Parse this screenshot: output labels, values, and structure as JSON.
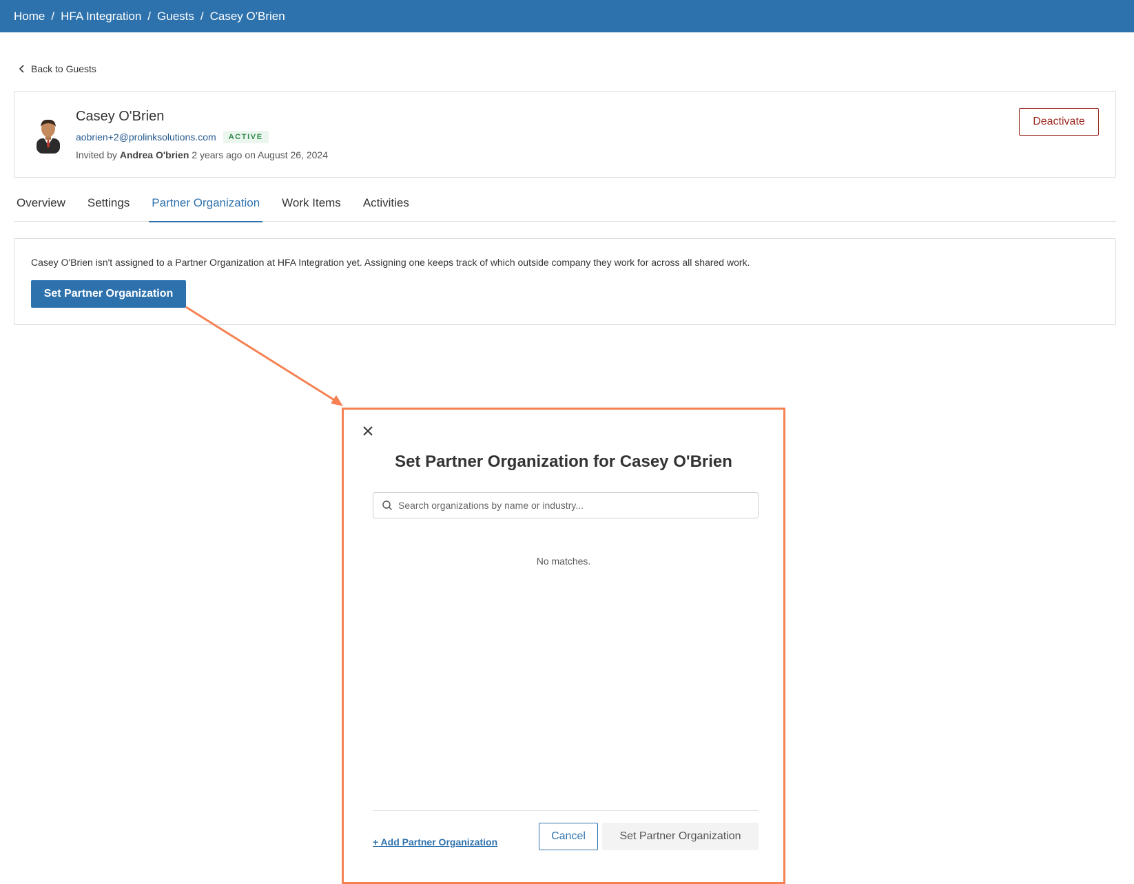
{
  "breadcrumb": [
    "Home",
    "HFA Integration",
    "Guests",
    "Casey O'Brien"
  ],
  "back_link": {
    "label": "Back to Guests",
    "icon": "chevron-left-icon"
  },
  "profile": {
    "name": "Casey O'Brien",
    "email": "aobrien+2@prolinksolutions.com",
    "status": "ACTIVE",
    "invited_prefix": "Invited by",
    "invited_by": "Andrea O'brien",
    "invited_suffix": "2 years ago on August 26, 2024",
    "deactivate_label": "Deactivate"
  },
  "tabs": [
    {
      "label": "Overview",
      "active": false
    },
    {
      "label": "Settings",
      "active": false
    },
    {
      "label": "Partner Organization",
      "active": true
    },
    {
      "label": "Work Items",
      "active": false
    },
    {
      "label": "Activities",
      "active": false
    }
  ],
  "empty_state": {
    "message": "Casey O'Brien isn't assigned to a Partner Organization at HFA Integration yet. Assigning one keeps track of which outside company they work for across all shared work.",
    "button_label": "Set Partner Organization"
  },
  "modal": {
    "title": "Set Partner Organization for Casey O'Brien",
    "search_placeholder": "Search organizations by name or industry...",
    "search_value": "",
    "empty_result": "No matches.",
    "add_link": "+ Add Partner Organization",
    "cancel_label": "Cancel",
    "submit_label": "Set Partner Organization",
    "submit_disabled": true
  },
  "colors": {
    "brand": "#2e72ad",
    "highlight": "#f58152",
    "danger": "#9b2b22",
    "status_active": "#2f8a4a"
  }
}
